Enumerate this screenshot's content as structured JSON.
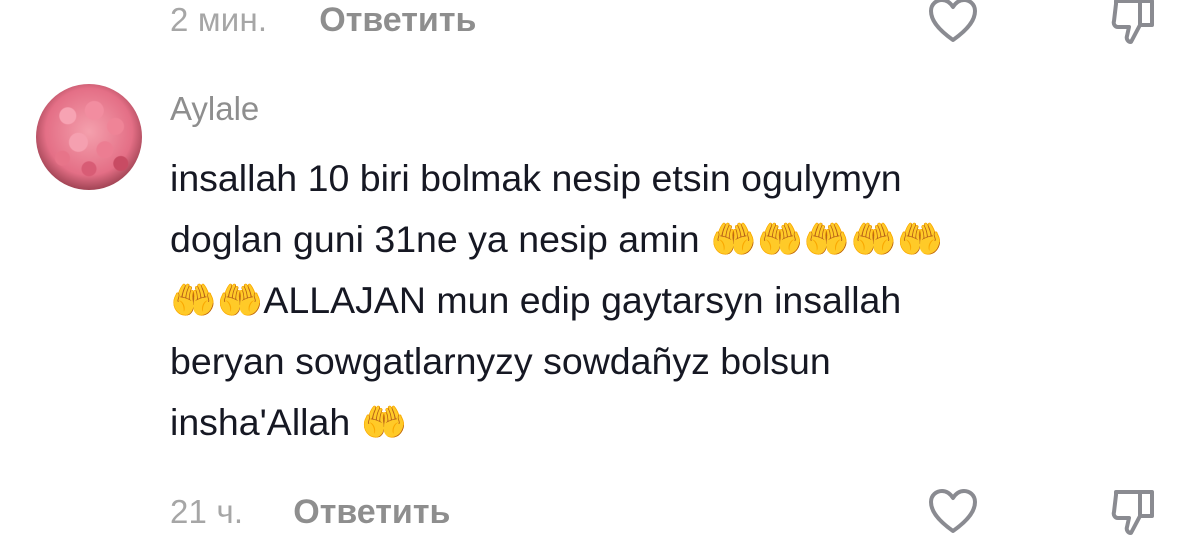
{
  "previous_comment_footer": {
    "time": "2 мин.",
    "reply_label": "Ответить",
    "like_icon": "heart-outline-icon",
    "dislike_icon": "thumbs-down-icon"
  },
  "comment": {
    "username": "Aylale",
    "avatar_alt": "roses-avatar",
    "text": "insallah 10 biri bolmak nesip etsin ogulymyn\ndoglan guni 31ne ya nesip amin 🤲🤲🤲🤲🤲\n🤲🤲ALLAJAN mun edip gaytarsyn insallah\nberyan sowgatlarnyzy sowdañyz bolsun\ninsha'Allah 🤲",
    "time": "21 ч.",
    "reply_label": "Ответить",
    "like_icon": "heart-outline-icon",
    "dislike_icon": "thumbs-down-icon"
  },
  "colors": {
    "muted_text": "#8e8e8e",
    "time_text": "#a6a6a6",
    "body_text": "#161823",
    "icon_stroke": "#8a8b91"
  }
}
